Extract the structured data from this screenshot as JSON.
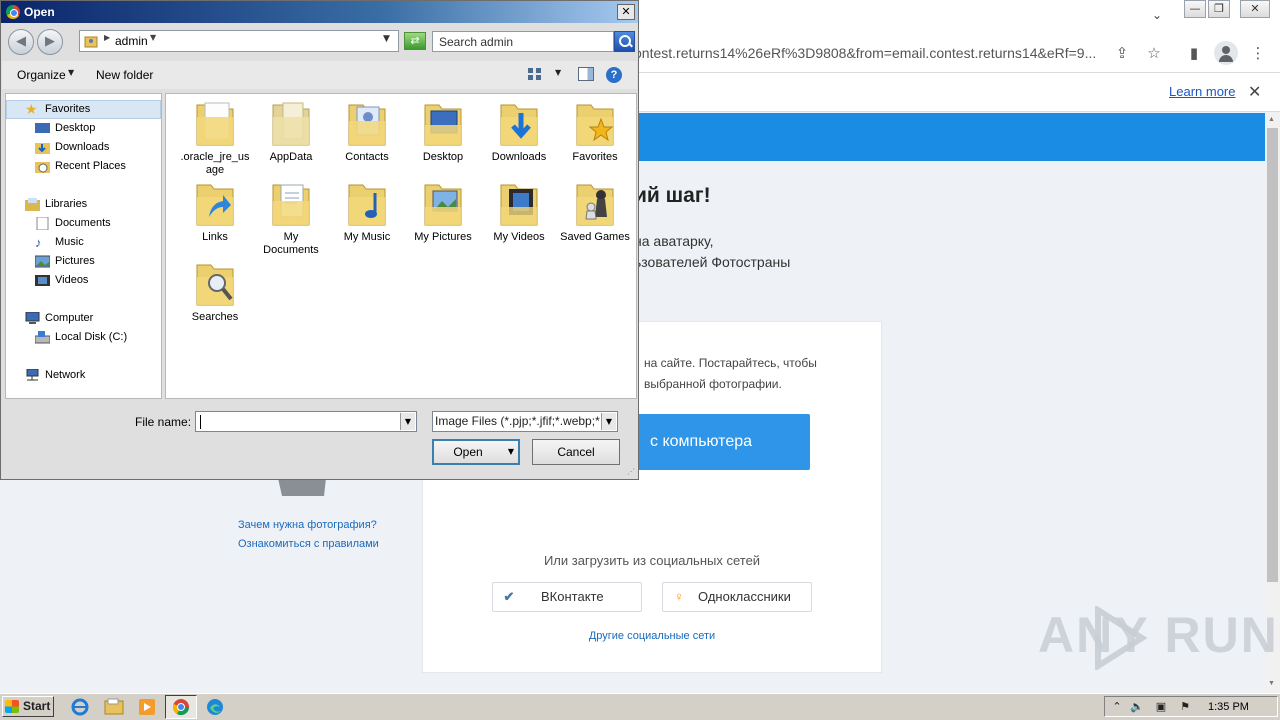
{
  "browser": {
    "url": "ontest.returns14%26eRf%3D9808&from=email.contest.returns14&eRf=9...",
    "infobar": {
      "learn_more": "Learn more"
    },
    "page": {
      "heading": "ий шаг!",
      "subtext_line1": "на аватарку,",
      "subtext_line2": "ьзователей Фотостраны",
      "card_text_line1": "на сайте. Постарайтесь, чтобы",
      "card_text_line2": "выбранной фотографии.",
      "upload_button": "с компьютера",
      "social_caption": "Или загрузить из социальных сетей",
      "vk_label": "ВКонтакте",
      "ok_label": "Одноклассники",
      "other_social": "Другие социальные сети",
      "side_link1": "Зачем нужна фотография?",
      "side_link2": "Ознакомиться с правилами"
    },
    "watermark": "ANY    RUN"
  },
  "dialog": {
    "title": "Open",
    "address": "admin",
    "search_placeholder": "Search admin",
    "organize": "Organize",
    "new_folder": "New folder",
    "nav": {
      "favorites": "Favorites",
      "desktop": "Desktop",
      "downloads": "Downloads",
      "recent": "Recent Places",
      "libraries": "Libraries",
      "documents": "Documents",
      "music": "Music",
      "pictures": "Pictures",
      "videos": "Videos",
      "computer": "Computer",
      "local_disk": "Local Disk (C:)",
      "network": "Network"
    },
    "files": [
      ".oracle_jre_usage",
      "AppData",
      "Contacts",
      "Desktop",
      "Downloads",
      "Favorites",
      "Links",
      "My Documents",
      "My Music",
      "My Pictures",
      "My Videos",
      "Saved Games",
      "Searches"
    ],
    "file_name_label": "File name:",
    "file_name_value": "",
    "filter": "Image Files (*.pjp;*.jfif;*.webp;*",
    "open_button": "Open",
    "cancel_button": "Cancel"
  },
  "taskbar": {
    "start": "Start",
    "clock": "1:35 PM"
  }
}
